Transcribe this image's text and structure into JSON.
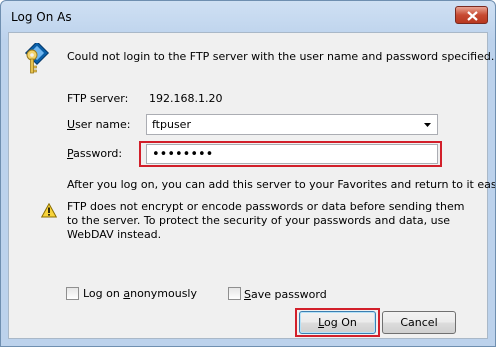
{
  "window": {
    "title": "Log On As"
  },
  "message": "Could not login to the FTP server with the user name and password specified.",
  "ftp_server": {
    "label": "FTP server:",
    "value": "192.168.1.20"
  },
  "username": {
    "label_u": "U",
    "label_rest": "ser name:",
    "value": "ftpuser"
  },
  "password": {
    "label_u": "P",
    "label_rest": "assword:",
    "value": "••••••••"
  },
  "after_text": "After you log on, you can add this server to your Favorites and return to it easily.",
  "warning_text": "FTP does not encrypt or encode passwords or data before sending them to the server.  To protect the security of your passwords and data, use WebDAV instead.",
  "anonymous": {
    "pre": "Log on ",
    "u": "a",
    "post": "nonymously",
    "checked": false
  },
  "save_password": {
    "u": "S",
    "post": "ave password",
    "checked": false
  },
  "buttons": {
    "logon_u": "L",
    "logon_rest": "og On",
    "cancel": "Cancel"
  },
  "colors": {
    "highlight": "#d21f2a",
    "close": "#c74a32"
  },
  "icons": {
    "key": "key-icon",
    "warning": "warning-icon",
    "close": "close-icon",
    "dropdown": "chevron-down-icon"
  }
}
